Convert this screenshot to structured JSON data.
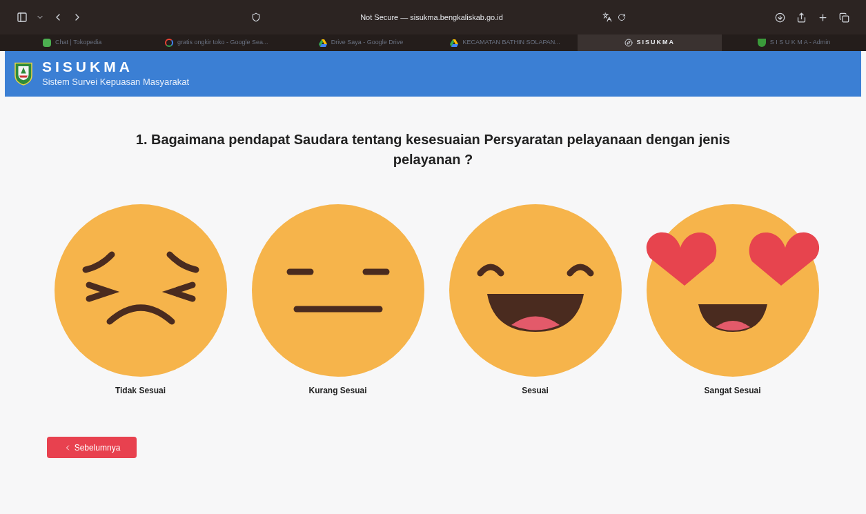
{
  "browser": {
    "address": "Not Secure — sisukma.bengkaliskab.go.id",
    "tabs": [
      {
        "label": "Chat | Tokopedia",
        "selected": false,
        "kind": "chat"
      },
      {
        "label": "gratis ongkir toko - Google Sea...",
        "selected": false,
        "kind": "google"
      },
      {
        "label": "Drive Saya - Google Drive",
        "selected": false,
        "kind": "drive"
      },
      {
        "label": "KECAMATAN BATHIN SOLAPAN...",
        "selected": false,
        "kind": "drive"
      },
      {
        "label": "SISUKMA",
        "selected": true,
        "kind": "compass"
      },
      {
        "label": "S I S U K M A - Admin",
        "selected": false,
        "kind": "crest"
      }
    ]
  },
  "header": {
    "title": "SISUKMA",
    "subtitle": "Sistem Survei Kepuasan Masyarakat"
  },
  "question": "1. Bagaimana pendapat Saudara tentang kesesuaian Persyaratan pelayanaan dengan jenis pelayanan ?",
  "options": [
    {
      "kind": "persevere",
      "label": "Tidak Sesuai"
    },
    {
      "kind": "neutral",
      "label": "Kurang Sesuai"
    },
    {
      "kind": "smile",
      "label": "Sesuai"
    },
    {
      "kind": "hearts",
      "label": "Sangat Sesuai"
    }
  ],
  "back_button": "Sebelumnya"
}
